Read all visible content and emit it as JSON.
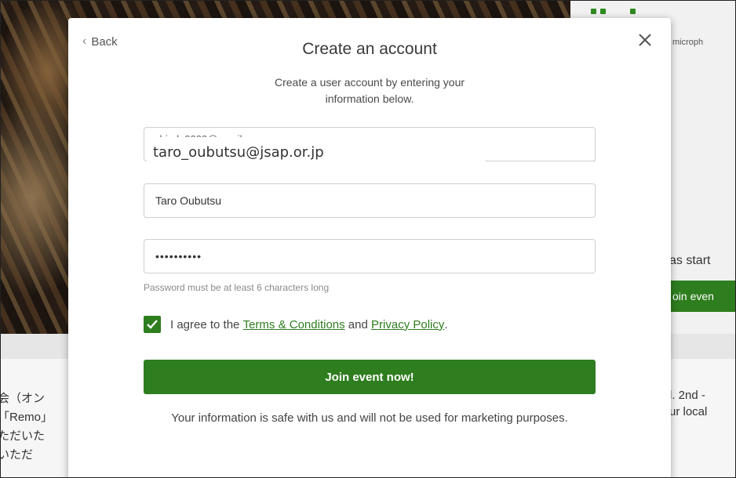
{
  "colors": {
    "accent_green": "#2e7d1e",
    "modal_bg": "#ffffff",
    "overlay_dark": "#3a2a1f"
  },
  "background": {
    "mic_text": "microph",
    "started_text": "as start",
    "join_button_label": "oin even",
    "right_lines": [
      "l. 2nd -",
      "ur local"
    ],
    "left_lines": [
      "会（オン",
      "「Remo」",
      "ただいた",
      "いただ"
    ]
  },
  "modal": {
    "back_label": "Back",
    "close_icon": "close-icon",
    "title": "Create an account",
    "subtitle": "Create a user account by entering your information below.",
    "email": {
      "value_original": "shiodo0000@gmail.com",
      "value_overlay": "taro_oubutsu@jsap.or.jp"
    },
    "name": {
      "value": "Taro Oubutsu"
    },
    "password": {
      "value": "••••••••••"
    },
    "password_hint": "Password must be at least 6 characters long",
    "agree": {
      "checked": true,
      "text_before": "I agree to the ",
      "terms_link": "Terms & Conditions",
      "text_middle": " and ",
      "privacy_link": "Privacy Policy",
      "text_after": "."
    },
    "join_button_label": "Join event now!",
    "safe_text": "Your information is safe with us and will not be used for marketing purposes."
  }
}
